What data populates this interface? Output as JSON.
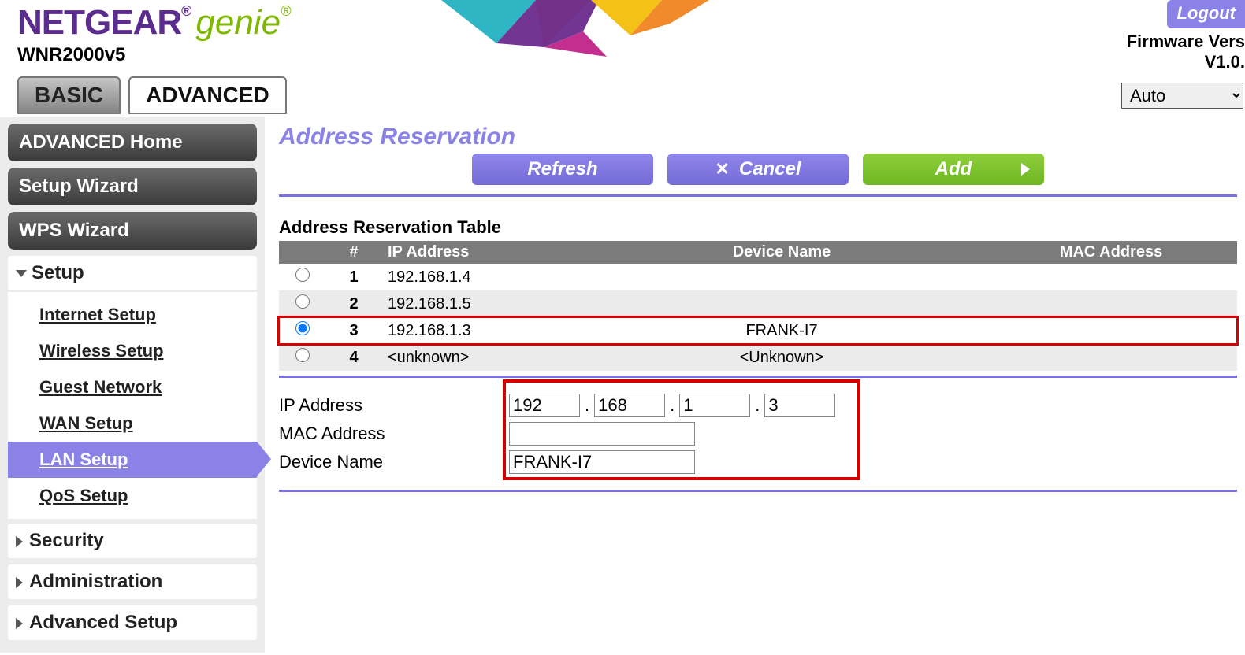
{
  "header": {
    "brand_main": "NETGEAR",
    "brand_sub": "genie",
    "model": "WNR2000v5",
    "logout": "Logout",
    "firmware_label": "Firmware Vers",
    "firmware_version": "V1.0."
  },
  "tabs": {
    "basic": "BASIC",
    "advanced": "ADVANCED"
  },
  "language_select": "Auto",
  "sidebar": {
    "buttons": [
      {
        "label": "ADVANCED Home"
      },
      {
        "label": "Setup Wizard"
      },
      {
        "label": "WPS Wizard"
      }
    ],
    "setup_label": "Setup",
    "setup_items": [
      "Internet Setup",
      "Wireless Setup",
      "Guest Network",
      "WAN Setup",
      "LAN Setup",
      "QoS Setup"
    ],
    "collapsed": [
      "Security",
      "Administration",
      "Advanced Setup"
    ]
  },
  "page": {
    "title": "Address Reservation",
    "buttons": {
      "refresh": "Refresh",
      "cancel": "Cancel",
      "add": "Add"
    },
    "table_title": "Address Reservation Table",
    "table_headers": {
      "num": "#",
      "ip": "IP Address",
      "device": "Device Name",
      "mac": "MAC Address"
    },
    "rows": [
      {
        "num": "1",
        "ip": "192.168.1.4",
        "device": "",
        "selected": false
      },
      {
        "num": "2",
        "ip": "192.168.1.5",
        "device": "",
        "selected": false
      },
      {
        "num": "3",
        "ip": "192.168.1.3",
        "device": "FRANK-I7",
        "selected": true
      },
      {
        "num": "4",
        "ip": "<unknown>",
        "device": "<Unknown>",
        "selected": false
      }
    ],
    "form": {
      "ip_label": "IP Address",
      "mac_label": "MAC Address",
      "device_label": "Device Name",
      "ip_octets": [
        "192",
        "168",
        "1",
        "3"
      ],
      "mac_value": "",
      "device_value": "FRANK-I7"
    }
  }
}
